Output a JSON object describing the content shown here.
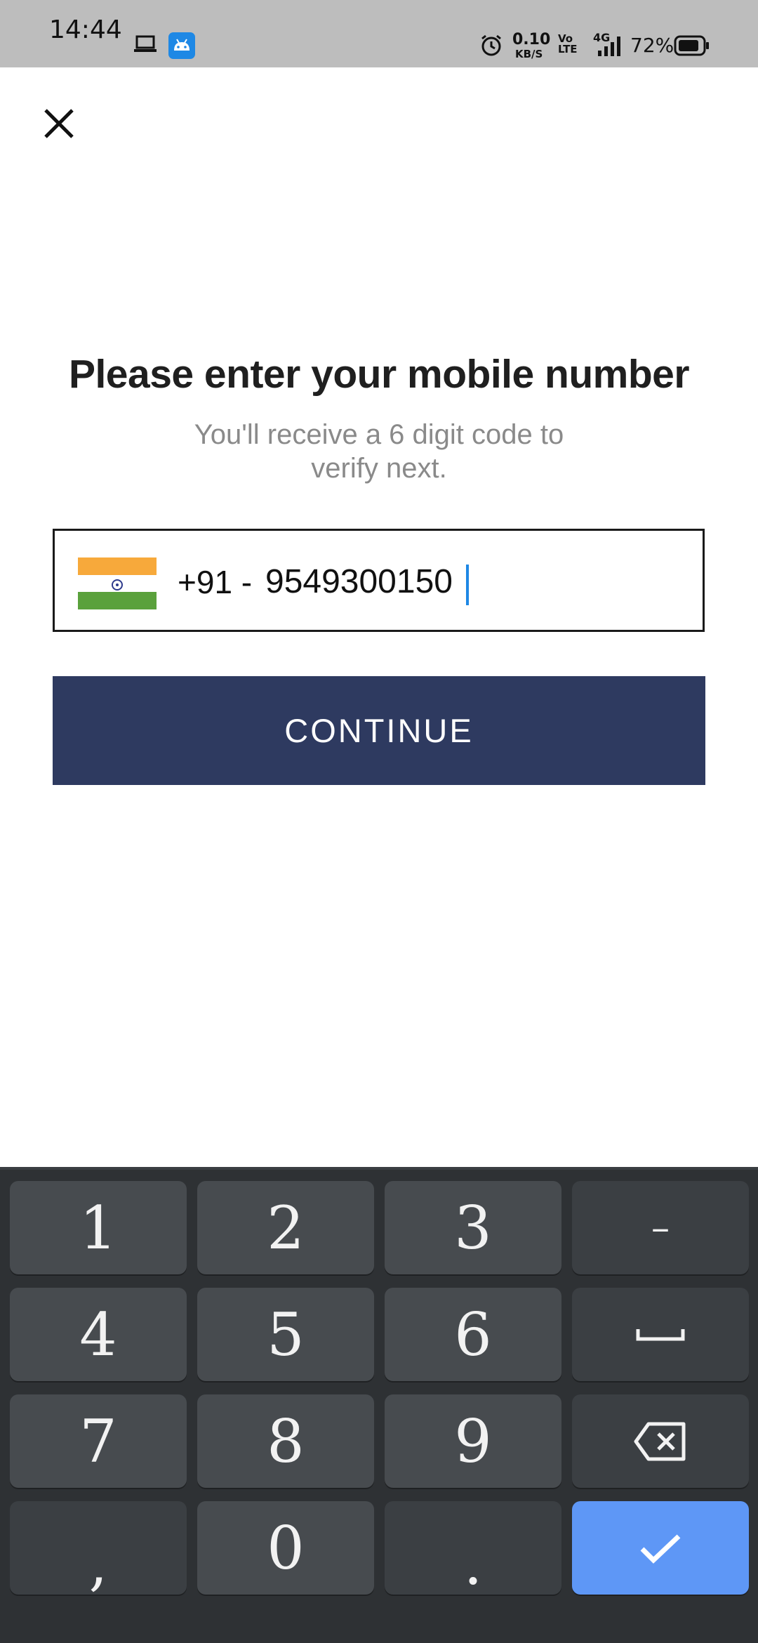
{
  "status_bar": {
    "time": "14:44",
    "net_speed_value": "0.10",
    "net_speed_unit": "KB/S",
    "volte": "Vo LTE",
    "network_type": "4G",
    "battery_percent": "72%",
    "icons": [
      "laptop-icon",
      "android-icon",
      "alarm-icon",
      "signal-icon",
      "battery-icon"
    ]
  },
  "header": {
    "close_icon": "close-icon"
  },
  "main": {
    "title": "Please enter your mobile number",
    "subtitle": "You'll receive a 6 digit code to verify next.",
    "country_flag": "india-flag",
    "country_code": "+91 - ",
    "phone_value": "9549300150",
    "continue_label": "CONTINUE"
  },
  "keyboard": {
    "keys": [
      {
        "label": "1"
      },
      {
        "label": "2"
      },
      {
        "label": "3"
      },
      {
        "label": "–"
      },
      {
        "label": "4"
      },
      {
        "label": "5"
      },
      {
        "label": "6"
      },
      {
        "label": "space-icon"
      },
      {
        "label": "7"
      },
      {
        "label": "8"
      },
      {
        "label": "9"
      },
      {
        "label": "backspace-icon"
      },
      {
        "label": ","
      },
      {
        "label": "0"
      },
      {
        "label": "."
      },
      {
        "label": "check-icon"
      }
    ]
  },
  "colors": {
    "primary_button": "#2e3a60",
    "keyboard_bg": "#2e3134",
    "key_bg": "#474b4f",
    "enter_key": "#5e97f6",
    "caret": "#1e88e5"
  }
}
